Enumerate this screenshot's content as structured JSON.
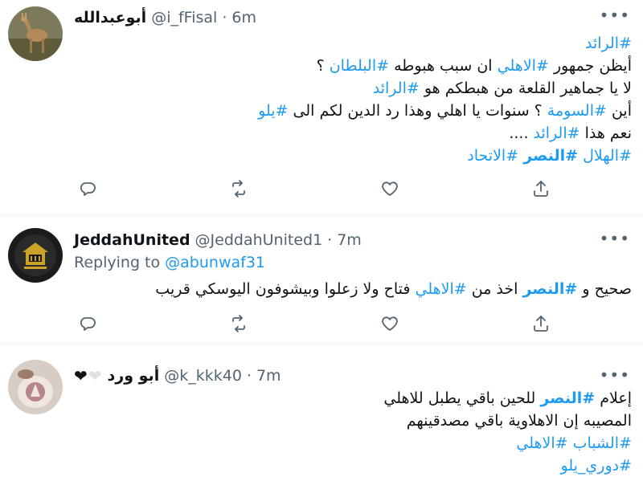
{
  "tweets": [
    {
      "display_name": "أبوعبدالله",
      "handle": "@i_fFisal",
      "dot": "·",
      "time": "6m",
      "more": "•••",
      "lines": [
        [
          {
            "t": "#الرائد",
            "tag": true
          }
        ],
        [
          {
            "t": "أيظن جمهور ",
            "tag": false
          },
          {
            "t": "#الاهلي",
            "tag": true
          },
          {
            "t": " ان سبب هبوطه ",
            "tag": false
          },
          {
            "t": "#البلطان",
            "tag": true
          },
          {
            "t": " ؟",
            "tag": false
          }
        ],
        [
          {
            "t": "لا يا جماهير القلعة من هبطكم هو ",
            "tag": false
          },
          {
            "t": "#الرائد",
            "tag": true
          }
        ],
        [
          {
            "t": "أين ",
            "tag": false
          },
          {
            "t": "#السومة",
            "tag": true
          },
          {
            "t": " ؟ سنوات يا اهلي وهذا رد الدين لكم الى ",
            "tag": false
          },
          {
            "t": "#يلو",
            "tag": true
          }
        ],
        [
          {
            "t": "نعم هذا ",
            "tag": false
          },
          {
            "t": "#الرائد",
            "tag": true
          },
          {
            "t": " ....",
            "tag": false
          }
        ],
        [
          {
            "t": "#الهلال",
            "tag": true
          },
          {
            "t": " ",
            "tag": false
          },
          {
            "t": "#النصر",
            "tag": true,
            "bold": true
          },
          {
            "t": " ",
            "tag": false
          },
          {
            "t": "#الاتحاد",
            "tag": true
          }
        ]
      ]
    },
    {
      "display_name": "JeddahUnited",
      "handle": "@JeddahUnited1",
      "dot": "·",
      "time": "7m",
      "more": "•••",
      "replying_prefix": "Replying to ",
      "replying_to": "@abunwaf31",
      "lines": [
        [
          {
            "t": "صحيح و ",
            "tag": false
          },
          {
            "t": "#النصر",
            "tag": true,
            "bold": true
          },
          {
            "t": " اخذ من ",
            "tag": false
          },
          {
            "t": "#الاهلي",
            "tag": true
          },
          {
            "t": " فتاح ولا زعلوا وبيشوفون اليوسكي قريب",
            "tag": false
          }
        ]
      ]
    },
    {
      "display_name": "أبو ورد",
      "hearts_black": "❤",
      "hearts_white": "❤",
      "handle": "@k_kkk40",
      "dot": "·",
      "time": "7m",
      "more": "•••",
      "lines": [
        [
          {
            "t": "إعلام ",
            "tag": false
          },
          {
            "t": "#النصر",
            "tag": true,
            "bold": true
          },
          {
            "t": " للحين باقي يطبل للاهلي",
            "tag": false
          }
        ],
        [
          {
            "t": "المصيبه إن الاهلاوية باقي مصدقينهم",
            "tag": false
          }
        ],
        [
          {
            "t": "#الشباب",
            "tag": true
          },
          {
            "t": " ",
            "tag": false
          },
          {
            "t": "#الاهلي",
            "tag": true
          }
        ],
        [
          {
            "t": "#دوري_يلو",
            "tag": true
          }
        ]
      ]
    }
  ],
  "actions": [
    "reply-icon",
    "retweet-icon",
    "like-icon",
    "share-icon"
  ],
  "colors": {
    "link": "#1d9bf0",
    "secondary": "#536471",
    "text": "#0f1419",
    "divider": "#eff3f4"
  }
}
